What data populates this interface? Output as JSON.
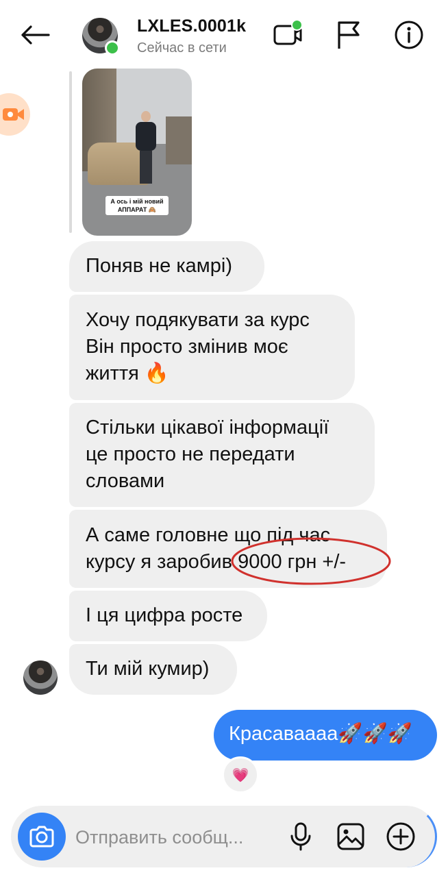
{
  "header": {
    "contact_name": "LXLES.0001k",
    "status": "Сейчас в сети",
    "icons": [
      "back-arrow-icon",
      "video-call-icon",
      "flag-icon",
      "info-icon"
    ]
  },
  "story_reply": {
    "caption": "А ось і мій новий АППАРАТ 🙈"
  },
  "messages": [
    {
      "direction": "received",
      "text": "Поняв не камрі)"
    },
    {
      "direction": "received",
      "text": "Хочу подякувати за курс\nВін просто змінив моє\nжиття 🔥"
    },
    {
      "direction": "received",
      "text": "Стільки цікавої інформації\nце просто не передати\nсловами"
    },
    {
      "direction": "received",
      "text": "А саме головне що під час\nкурсу я заробив 9000 грн +/-"
    },
    {
      "direction": "received",
      "text": "І ця цифра росте"
    },
    {
      "direction": "received",
      "text": "Ти мій кумир)"
    },
    {
      "direction": "sent",
      "text": "Красаваааа🚀🚀🚀"
    }
  ],
  "reaction": "💗",
  "composer": {
    "placeholder": "Отправить сообщ...",
    "icons": [
      "camera-icon",
      "microphone-icon",
      "gallery-icon",
      "plus-icon"
    ]
  },
  "colors": {
    "sent_bubble": "#3483f6",
    "received_bubble": "#efefef",
    "online": "#3cc04a",
    "annotation": "#d0312d"
  }
}
